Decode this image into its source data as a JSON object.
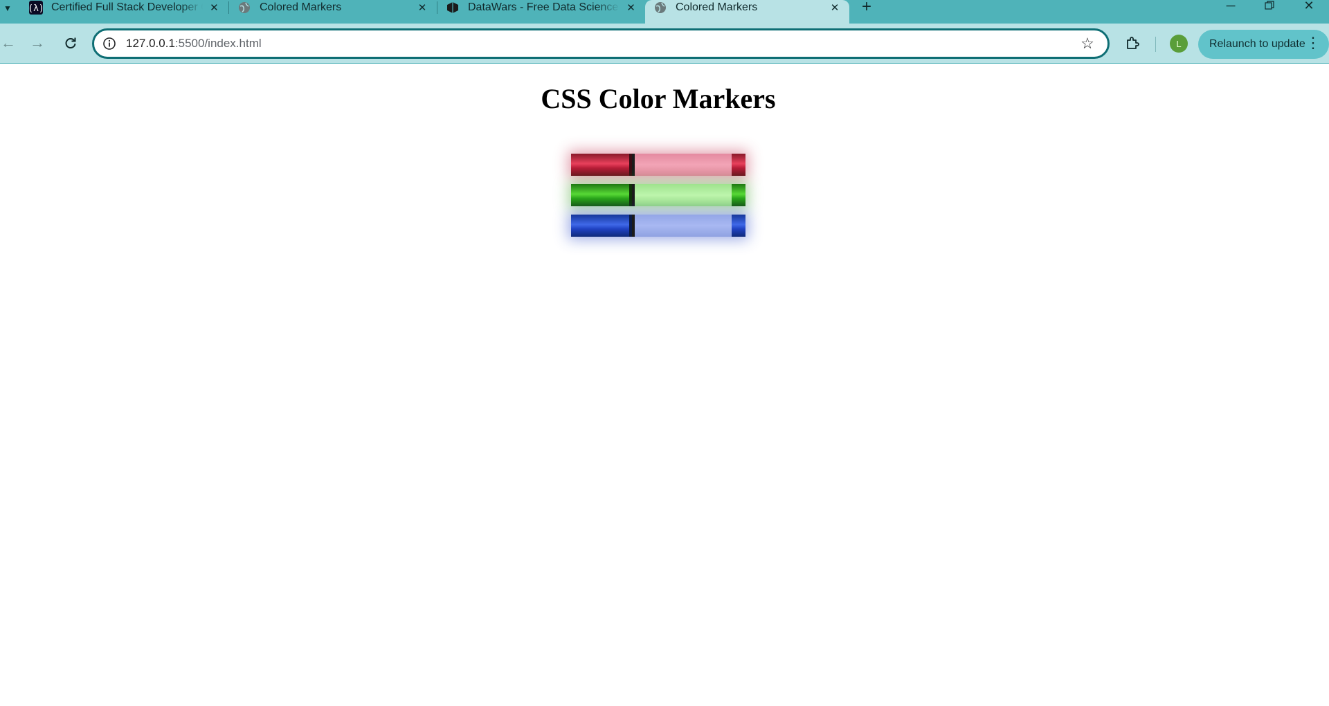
{
  "browser": {
    "tabs": [
      {
        "title": "Certified Full Stack Developer C",
        "icon": "freecodecamp-icon",
        "active": false
      },
      {
        "title": "Colored Markers",
        "icon": "globe-icon",
        "active": false
      },
      {
        "title": "DataWars - Free Data Science Ir",
        "icon": "datawars-icon",
        "active": false
      },
      {
        "title": "Colored Markers",
        "icon": "globe-icon",
        "active": true
      }
    ],
    "address": {
      "host": "127.0.0.1",
      "rest": ":5500/index.html"
    },
    "profile_initial": "L",
    "relaunch_label": "Relaunch to update",
    "colors": {
      "tabstrip": "#4fb3b9",
      "toolbar": "#b8e2e5",
      "relaunch": "#61c3ca",
      "avatar": "#5a9e3a"
    }
  },
  "page": {
    "heading": "CSS Color Markers",
    "markers": [
      {
        "color": "red",
        "cap": "#e8405c",
        "sleeve": "#f2a4b6"
      },
      {
        "color": "green",
        "cap": "#58d936",
        "sleeve": "#bdf5ac"
      },
      {
        "color": "blue",
        "cap": "#3f68e8",
        "sleeve": "#a8b8f2"
      }
    ]
  }
}
